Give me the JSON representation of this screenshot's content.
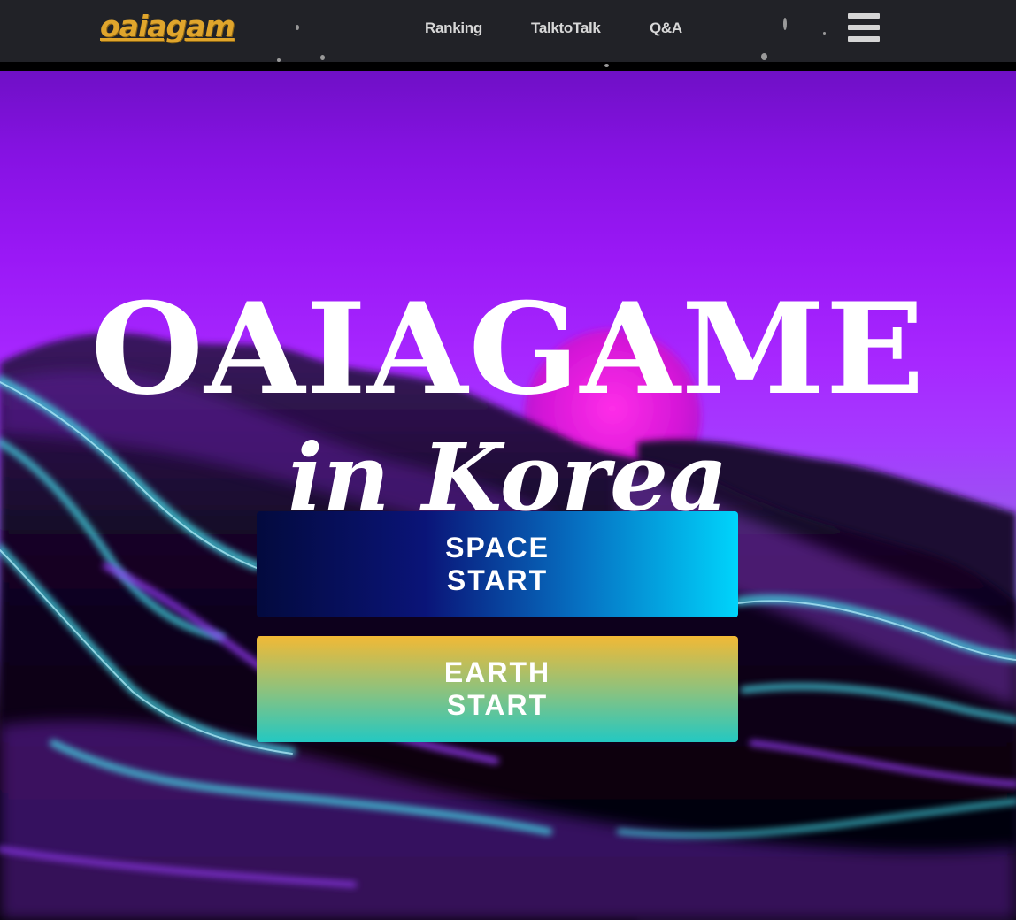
{
  "nav": {
    "logo": "oaiagam",
    "links": [
      "Ranking",
      "TalktoTalk",
      "Q&A"
    ],
    "menu_icon": "hamburger-menu-icon"
  },
  "hero": {
    "title": "OAIAGAME",
    "subtitle": "in Korea"
  },
  "buttons": {
    "space": [
      "SPACE",
      "START"
    ],
    "earth": [
      "EARTH",
      "START"
    ]
  },
  "colors": {
    "nav_bg": "#212227",
    "logo": "#e0a52c",
    "sky_purple": "#a727ff",
    "sun_pink": "#e61be0",
    "wave_cyan": "#3fd2e0",
    "space_btn": [
      "#030a3e",
      "#00d4fb"
    ],
    "earth_btn": [
      "#f2b935",
      "#23c8c2"
    ]
  }
}
